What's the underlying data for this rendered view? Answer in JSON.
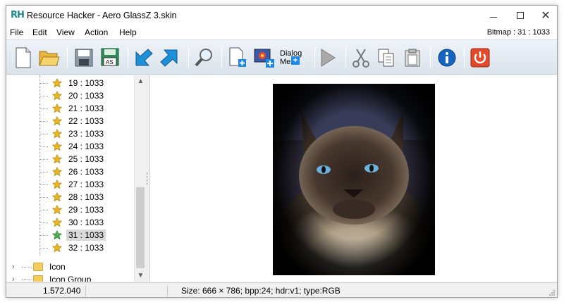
{
  "window": {
    "title": "Resource Hacker - Aero GlassZ 3.skin",
    "app_icon": "RH"
  },
  "menu": {
    "items": [
      "File",
      "Edit",
      "View",
      "Action",
      "Help"
    ],
    "resource_label": "Bitmap : 31 : 1033"
  },
  "toolbar": {
    "dialog_menu_label_1": "Dialog",
    "dialog_menu_label_2": "Mer",
    "icons": [
      "new-file-icon",
      "open-folder-icon",
      "save-icon",
      "save-as-icon",
      "back-arrow-icon",
      "forward-arrow-icon",
      "find-icon",
      "add-resource-icon",
      "add-image-icon",
      "dialog-menu-icon",
      "play-icon",
      "cut-icon",
      "copy-icon",
      "paste-icon",
      "info-icon",
      "power-icon"
    ]
  },
  "tree": {
    "items": [
      "19 : 1033",
      "20 : 1033",
      "21 : 1033",
      "22 : 1033",
      "23 : 1033",
      "24 : 1033",
      "25 : 1033",
      "26 : 1033",
      "27 : 1033",
      "28 : 1033",
      "29 : 1033",
      "30 : 1033",
      "31 : 1033",
      "32 : 1033"
    ],
    "selected": "31 : 1033",
    "folders": [
      "Icon",
      "Icon Group"
    ]
  },
  "status": {
    "position": "1.572.040",
    "info": "Size: 666 × 786;  bpp:24;  hdr:v1;  type:RGB"
  },
  "colors": {
    "star": "#e8b923",
    "selected_star": "#4caf50",
    "folder": "#f3cd5b",
    "accent": "#1e88e5"
  }
}
